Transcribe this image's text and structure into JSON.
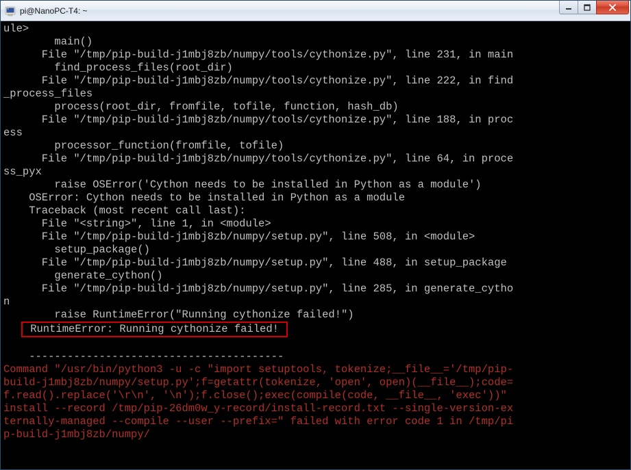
{
  "window": {
    "title": "pi@NanoPC-T4: ~",
    "icon_name": "putty-icon"
  },
  "terminal": {
    "lines": [
      "ule>",
      "        main()",
      "      File \"/tmp/pip-build-j1mbj8zb/numpy/tools/cythonize.py\", line 231, in main",
      "        find_process_files(root_dir)",
      "      File \"/tmp/pip-build-j1mbj8zb/numpy/tools/cythonize.py\", line 222, in find",
      "_process_files",
      "        process(root_dir, fromfile, tofile, function, hash_db)",
      "      File \"/tmp/pip-build-j1mbj8zb/numpy/tools/cythonize.py\", line 188, in proc",
      "ess",
      "        processor_function(fromfile, tofile)",
      "      File \"/tmp/pip-build-j1mbj8zb/numpy/tools/cythonize.py\", line 64, in proce",
      "ss_pyx",
      "        raise OSError('Cython needs to be installed in Python as a module')",
      "    OSError: Cython needs to be installed in Python as a module",
      "    Traceback (most recent call last):",
      "      File \"<string>\", line 1, in <module>",
      "      File \"/tmp/pip-build-j1mbj8zb/numpy/setup.py\", line 508, in <module>",
      "        setup_package()",
      "      File \"/tmp/pip-build-j1mbj8zb/numpy/setup.py\", line 488, in setup_package",
      "        generate_cython()",
      "      File \"/tmp/pip-build-j1mbj8zb/numpy/setup.py\", line 285, in generate_cytho",
      "n",
      "        raise RuntimeError(\"Running cythonize failed!\")"
    ],
    "highlighted_line": "    RuntimeError: Running cythonize failed!",
    "blank_line": "    ",
    "dash_line": "    ----------------------------------------",
    "red_lines": [
      "Command \"/usr/bin/python3 -u -c \"import setuptools, tokenize;__file__='/tmp/pip-",
      "build-j1mbj8zb/numpy/setup.py';f=getattr(tokenize, 'open', open)(__file__);code=",
      "f.read().replace('\\r\\n', '\\n');f.close();exec(compile(code, __file__, 'exec'))\" ",
      "install --record /tmp/pip-26dm0w_y-record/install-record.txt --single-version-ex",
      "ternally-managed --compile --user --prefix=\" failed with error code 1 in /tmp/pi",
      "p-build-j1mbj8zb/numpy/"
    ]
  }
}
